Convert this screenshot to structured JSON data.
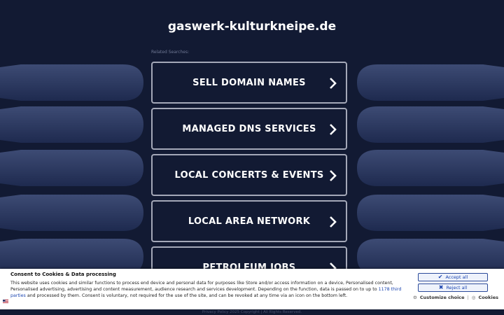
{
  "site": {
    "domain_title": "gaswerk-kulturkneipe.de",
    "related_label": "Related Searches:"
  },
  "links": [
    {
      "label": "SELL DOMAIN NAMES"
    },
    {
      "label": "MANAGED DNS SERVICES"
    },
    {
      "label": "LOCAL CONCERTS & EVENTS"
    },
    {
      "label": "LOCAL AREA NETWORK"
    },
    {
      "label": "PETROLEUM JOBS"
    }
  ],
  "consent": {
    "title": "Consent to Cookies & Data processing",
    "text_before_link": "This website uses cookies and similar functions to process end device and personal data for purposes like Store and/or access information on a device, Personalised content, Personalised advertising, advertising and content measurement, audience research and services development. Depending on the function, data is passed on to up to ",
    "link_text": "1178 third parties",
    "text_after_link": " and processed by them. Consent is voluntary, not required for the use of the site, and can be revoked at any time via an icon on the bottom left.",
    "accept_label": "Accept all",
    "reject_label": "Reject all",
    "customize_label": "Customize choice",
    "separator": "|",
    "cookies_label": "Cookies"
  },
  "footer": {
    "text": "Privacy Policy   2025 Copyright | All Rights Reserved."
  },
  "colors": {
    "background": "#121a33",
    "link_border": "#a4a8b8",
    "consent_accent": "#1b45b0"
  }
}
